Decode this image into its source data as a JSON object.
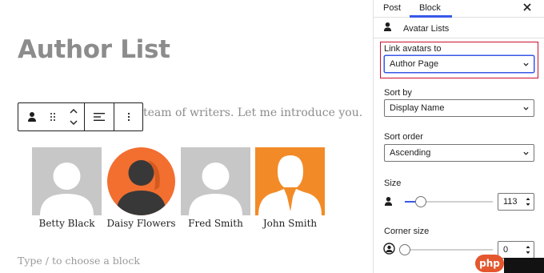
{
  "editor": {
    "title": "Author List",
    "intro_text": "team of writers. Let me introduce you.",
    "placeholder": "Type / to choose a block",
    "avatars": [
      {
        "name": "Betty Black",
        "style": "gray-silhouette"
      },
      {
        "name": "Daisy Flowers",
        "style": "orange-circle-dark-silhouette"
      },
      {
        "name": "Fred Smith",
        "style": "gray-silhouette"
      },
      {
        "name": "John Smith",
        "style": "orange-suit-silhouette"
      }
    ]
  },
  "toolbar": {
    "icons": [
      "avatar-block-icon",
      "drag-handle-icon",
      "move-up-down-icon",
      "align-left-icon",
      "more-options-icon"
    ]
  },
  "sidebar": {
    "tabs": [
      {
        "label": "Post",
        "active": false
      },
      {
        "label": "Block",
        "active": true
      }
    ],
    "close_icon": "close-icon",
    "block_name": "Avatar Lists",
    "link_avatars": {
      "label": "Link avatars to",
      "value": "Author Page"
    },
    "sort_by": {
      "label": "Sort by",
      "value": "Display Name"
    },
    "sort_order": {
      "label": "Sort order",
      "value": "Ascending"
    },
    "size": {
      "label": "Size",
      "value": "113",
      "fraction": 0.18
    },
    "corner_size": {
      "label": "Corner size",
      "value": "0",
      "fraction": 0.0
    }
  },
  "overlay": {
    "badge": "php"
  },
  "colors": {
    "accent": "#3858e9",
    "highlight": "#c8102e",
    "orange": "#f28b27",
    "avatar_gray": "#c7c7c7"
  }
}
